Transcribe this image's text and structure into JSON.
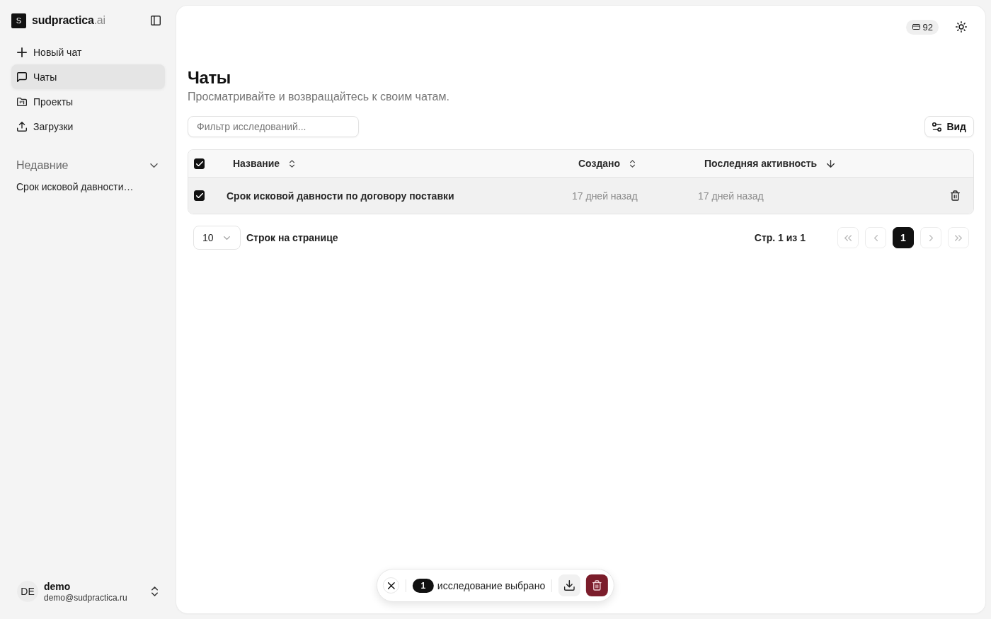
{
  "sidebar": {
    "logo_letter": "S",
    "brand": "sudpractica",
    "brand_suffix": ".ai",
    "nav": [
      {
        "label": "Новый чат",
        "selected": false
      },
      {
        "label": "Чаты",
        "selected": true
      },
      {
        "label": "Проекты",
        "selected": false
      },
      {
        "label": "Загрузки",
        "selected": false
      }
    ],
    "recent": {
      "title": "Недавние",
      "expanded": true,
      "items": [
        {
          "label": "Срок исковой давности…"
        }
      ]
    },
    "user": {
      "initials": "DE",
      "name": "demo",
      "email": "demo@sudpractica.ru"
    }
  },
  "topbar": {
    "credits": "92"
  },
  "page": {
    "title": "Чаты",
    "subtitle": "Просматривайте и возвращайтесь к своим чатам."
  },
  "toolbar": {
    "filter_placeholder": "Фильтр исследований...",
    "view_button": "Вид"
  },
  "table": {
    "all_checked": true,
    "columns": [
      {
        "label": "Название",
        "sorted": false
      },
      {
        "label": "Создано",
        "sorted": false
      },
      {
        "label": "Последняя активность",
        "sorted": true
      }
    ],
    "rows": [
      {
        "title": "Срок исковой давности по договору поставки",
        "created": "17 дней назад",
        "last_activity": "17 дней назад",
        "checked": true
      }
    ]
  },
  "pagination": {
    "rows_per_page": "10",
    "rows_label": "Строк на странице",
    "page_info": "Стр. 1 из 1",
    "back_disabled": true,
    "forward_disabled": true,
    "pages": [
      {
        "label": "1",
        "selected": true
      }
    ]
  },
  "selection_bar": {
    "count": "1",
    "label": "исследование выбрано"
  }
}
